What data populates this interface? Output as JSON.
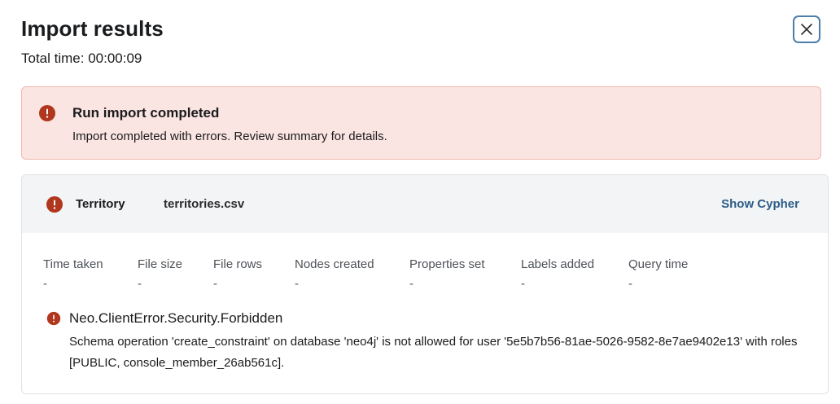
{
  "header": {
    "title": "Import results",
    "total_time": "Total time: 00:00:09"
  },
  "alert": {
    "title": "Run import completed",
    "description": "Import completed with errors. Review summary for details.",
    "icon": "error-icon",
    "colors": {
      "background": "#fbe5e2",
      "border": "#f2b8ae",
      "icon": "#b1361e"
    }
  },
  "result": {
    "label": "Territory",
    "file": "territories.csv",
    "show_cypher": "Show Cypher",
    "stats": [
      {
        "label": "Time taken",
        "value": "-"
      },
      {
        "label": "File size",
        "value": "-"
      },
      {
        "label": "File rows",
        "value": "-"
      },
      {
        "label": "Nodes created",
        "value": "-"
      },
      {
        "label": "Properties set",
        "value": "-"
      },
      {
        "label": "Labels added",
        "value": "-"
      },
      {
        "label": "Query time",
        "value": "-"
      }
    ],
    "error": {
      "title": "Neo.ClientError.Security.Forbidden",
      "message": "Schema operation 'create_constraint' on database 'neo4j' is not allowed for user '5e5b7b56-81ae-5026-9582-8e7ae9402e13' with roles [PUBLIC, console_member_26ab561c]."
    }
  },
  "colors": {
    "accent": "#2b5c87",
    "close_border": "#4c7ea8",
    "error_icon": "#b1361e"
  }
}
